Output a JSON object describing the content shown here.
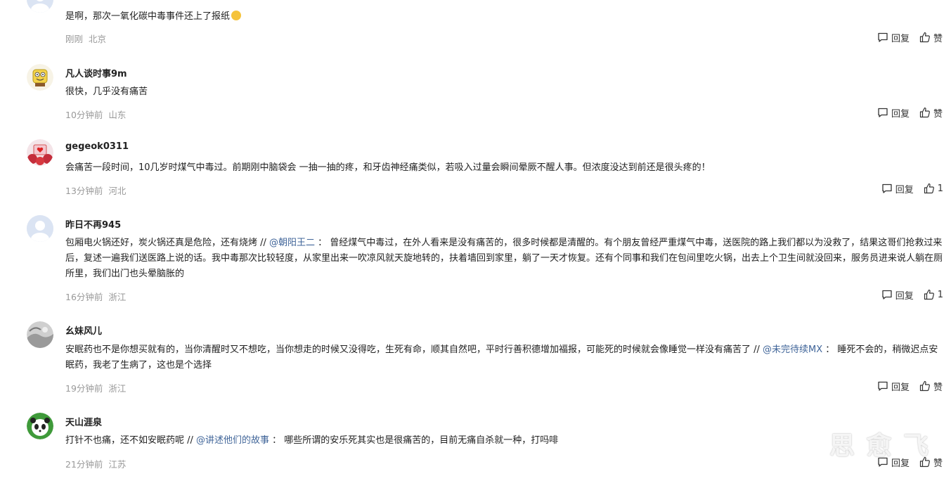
{
  "comments": [
    {
      "username": "",
      "text": "是啊，那次一氧化碳中毒事件还上了报纸",
      "time": "刚刚",
      "location": "北京",
      "reply_label": "回复",
      "like_label": "赞"
    },
    {
      "username": "凡人谈时事9m",
      "text": "很快，几乎没有痛苦",
      "time": "10分钟前",
      "location": "山东",
      "reply_label": "回复",
      "like_label": "赞"
    },
    {
      "username": "gegeok0311",
      "text": "会痛苦一段时间，10几岁时煤气中毒过。前期刚中脑袋会 一抽一抽的疼，和牙齿神经痛类似，若吸入过量会瞬间晕厥不醒人事。但浓度没达到前还是很头疼的！",
      "time": "13分钟前",
      "location": "河北",
      "reply_label": "回复",
      "like_label": "1"
    },
    {
      "username": "昨日不再945",
      "text_before": "包厢电火锅还好，炭火锅还真是危险，还有烧烤 // ",
      "mention": "@朝阳王二",
      "text_after": " ： 曾经煤气中毒过，在外人看来是没有痛苦的，很多时候都是清醒的。有个朋友曾经严重煤气中毒，送医院的路上我们都以为没救了，结果这哥们抢救过来后，复述一遍我们送医路上说的话。我中毒那次比较轻度，从家里出来一吹凉风就天旋地转的，扶着墙回到家里，躺了一天才恢复。还有个同事和我们在包间里吃火锅，出去上个卫生间就没回来，服务员进来说人躺在厕所里，我们出门也头晕脑胀的",
      "time": "16分钟前",
      "location": "浙江",
      "reply_label": "回复",
      "like_label": "1"
    },
    {
      "username": "幺妹风儿",
      "text_before": "安眠药也不是你想买就有的，当你清醒时又不想吃，当你想走的时候又没得吃，生死有命，顺其自然吧，平时行善积德增加福报，可能死的时候就会像睡觉一样没有痛苦了 // ",
      "mention": "@未完待续MX",
      "text_after": " ： 睡死不会的，稍微迟点安眠药，我老了生病了，这也是个选择",
      "time": "19分钟前",
      "location": "浙江",
      "reply_label": "回复",
      "like_label": "赞"
    },
    {
      "username": "天山涯泉",
      "text_before": "打针不也痛，还不如安眠药呢 // ",
      "mention": "@讲述他们的故事",
      "text_after": " ： 哪些所谓的安乐死其实也是很痛苦的，目前无痛自杀就一种，打吗啡",
      "time": "21分钟前",
      "location": "江苏",
      "reply_label": "回复",
      "like_label": "赞"
    }
  ],
  "watermark": "思 愈 飞",
  "colors": {
    "mention": "#406599",
    "meta": "#999999",
    "text": "#222222"
  },
  "icons": [
    "default-avatar-icon",
    "comment-bubble-icon",
    "thumbs-up-icon",
    "laughing-emoji-icon"
  ]
}
